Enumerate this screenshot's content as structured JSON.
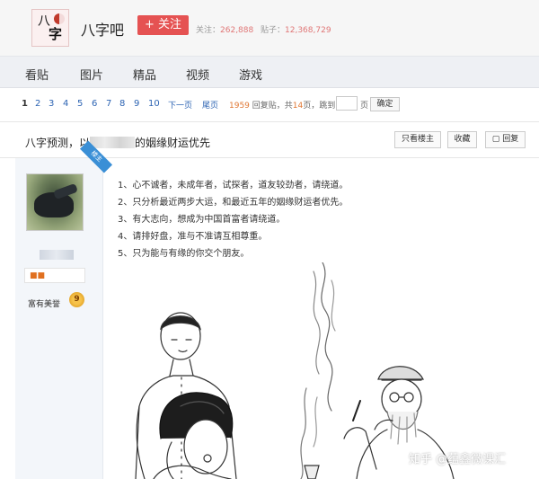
{
  "header": {
    "logo": {
      "char_top": "八",
      "char_bottom": "字"
    },
    "forum_name": "八字吧",
    "follow_label": "+ 关注",
    "followers_label": "关注：",
    "followers_value": "262,888",
    "posts_label": "贴子：",
    "posts_value": "12,368,729"
  },
  "nav": {
    "items": [
      "看贴",
      "图片",
      "精品",
      "视频",
      "游戏"
    ]
  },
  "pager": {
    "pages": [
      "1",
      "2",
      "3",
      "4",
      "5",
      "6",
      "7",
      "8",
      "9",
      "10"
    ],
    "current_page": "1",
    "next_label": "下一页",
    "last_label": "尾页",
    "reply_count": "1959",
    "reply_suffix": "回复贴，共",
    "total_pages": "14",
    "pages_suffix": "页，跳到",
    "page_unit": "页",
    "confirm_label": "确定"
  },
  "thread": {
    "title_prefix": "八字预测，以",
    "title_suffix": "的姻缘财运优先",
    "only_owner_label": "只看楼主",
    "collect_label": "收藏",
    "reply_label": "回复"
  },
  "author": {
    "badge_label": "富有美誉",
    "badge_level": "9",
    "owner_ribbon": "楼主"
  },
  "post": {
    "lines": [
      "1、心不诚者，未成年者，试探者，道友较劲者，请绕道。",
      "2、只分析最近两步大运，和最近五年的姻缘财运者优先。",
      "3、有大志向，想成为中国首富者请绕道。",
      "4、请排好盘，准与不准请互相尊重。",
      "5、只为能与有缘的你交个朋友。"
    ]
  },
  "watermark": "知乎 @蕴鑫微课汇",
  "colors": {
    "follow_button": "#e55252",
    "link_blue": "#2d64b3",
    "nav_background": "#eef0f4",
    "author_panel": "#f3f6fa",
    "owner_ribbon": "#3a8fd6"
  }
}
